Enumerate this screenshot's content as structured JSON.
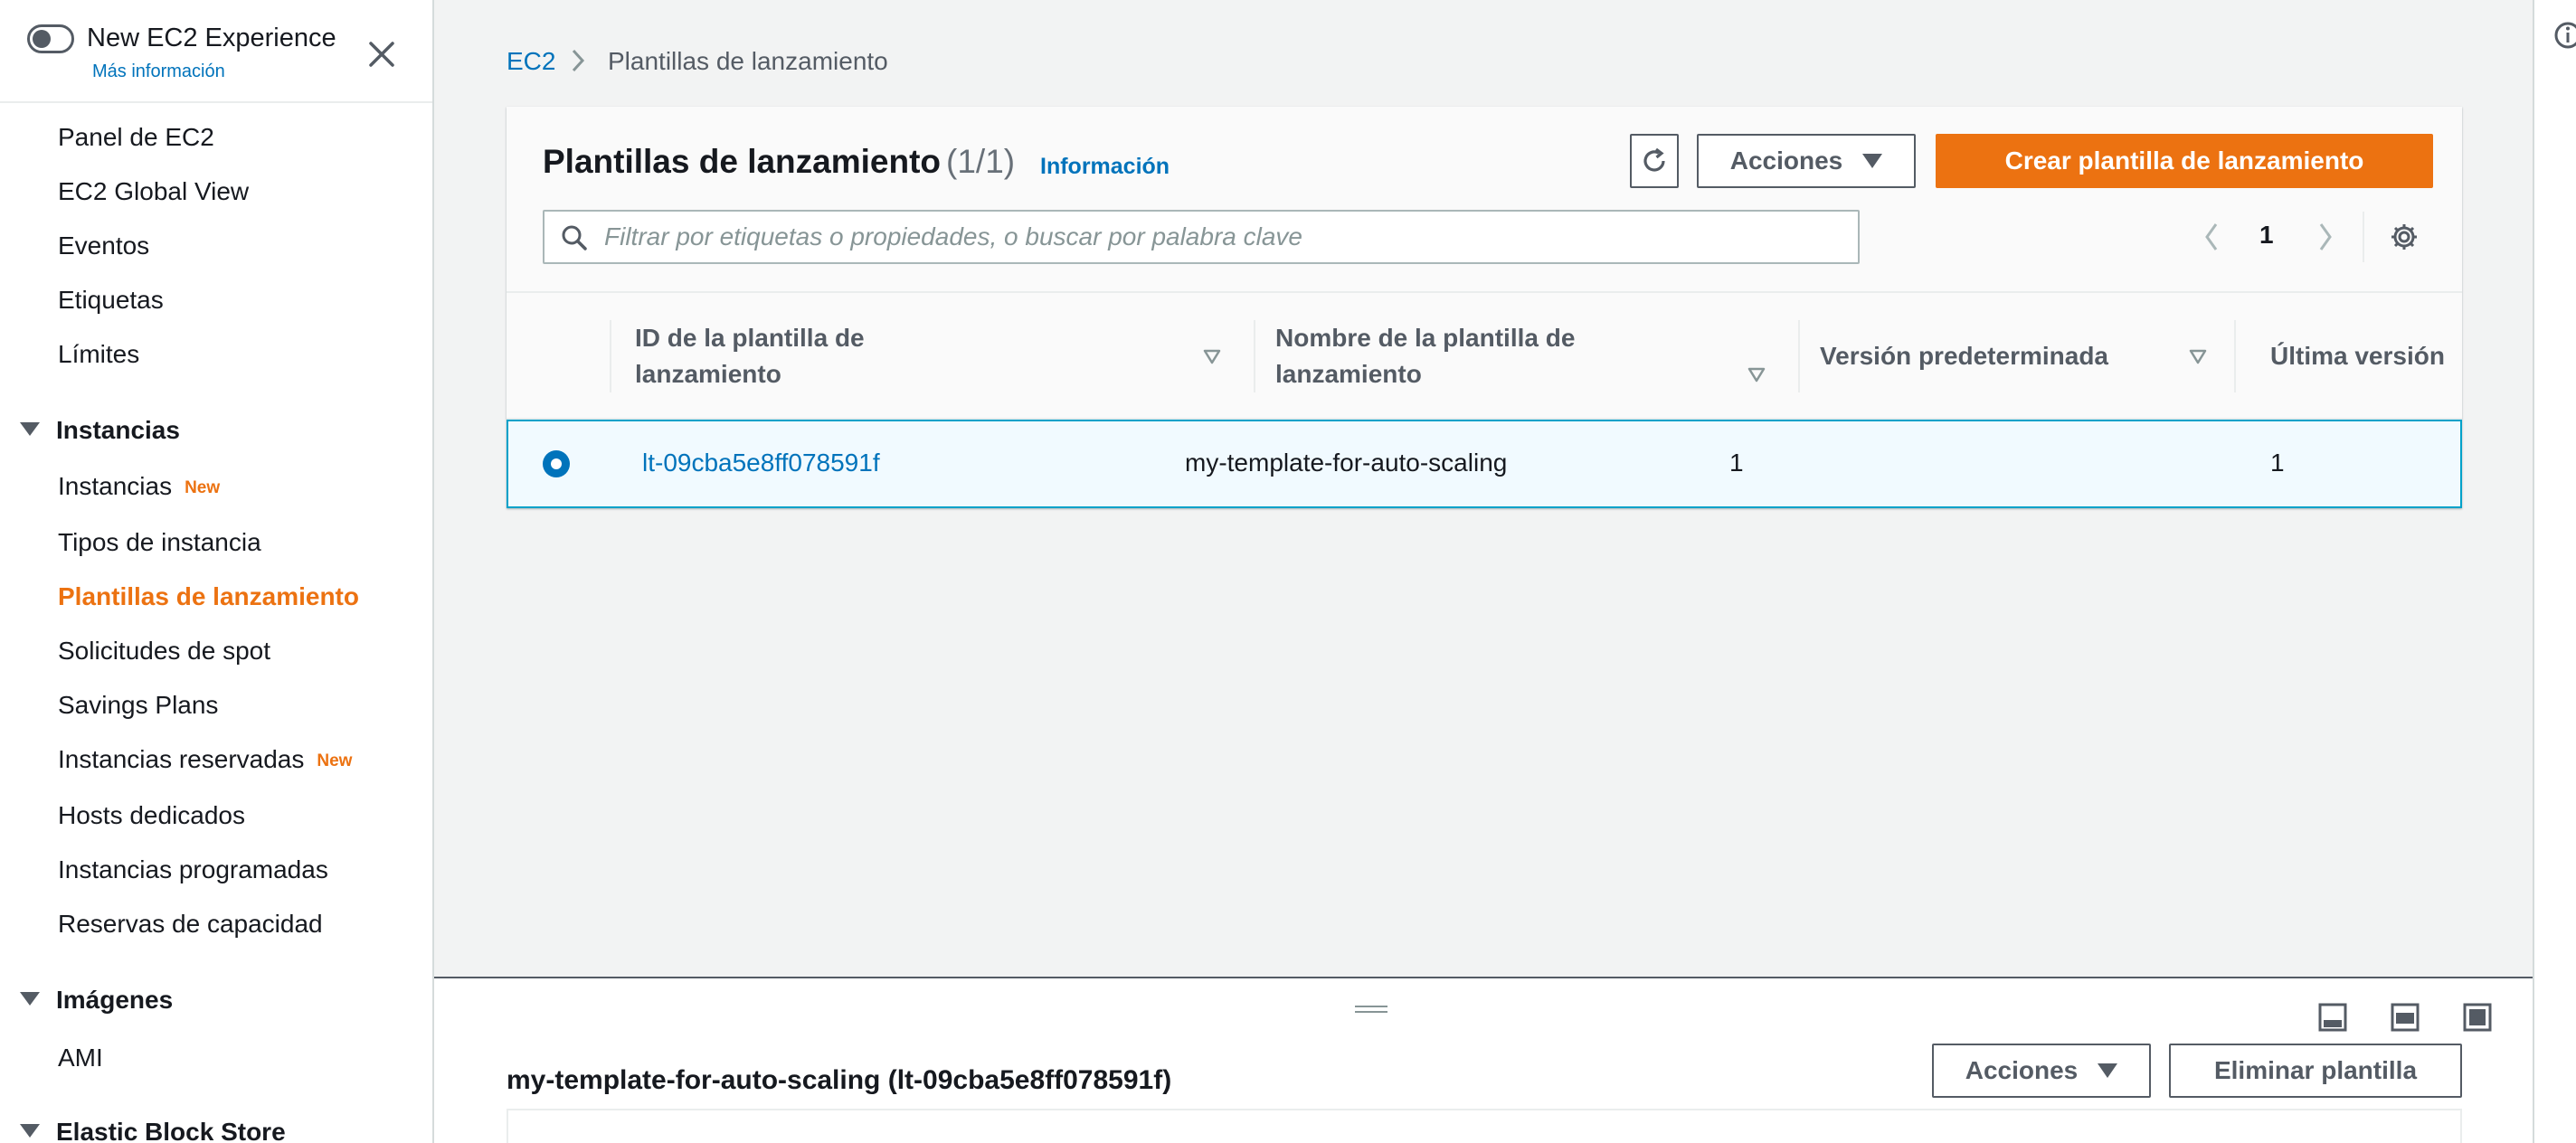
{
  "sidebar": {
    "experience_title": "New EC2 Experience",
    "experience_link": "Más información",
    "items": [
      {
        "label": "Panel de EC2"
      },
      {
        "label": "EC2 Global View"
      },
      {
        "label": "Eventos"
      },
      {
        "label": "Etiquetas"
      },
      {
        "label": "Límites"
      }
    ],
    "sections": [
      {
        "label": "Instancias"
      },
      {
        "label": "Imágenes"
      },
      {
        "label": "Elastic Block Store"
      }
    ],
    "instances_items": [
      {
        "label": "Instancias",
        "badge": "New"
      },
      {
        "label": "Tipos de instancia"
      },
      {
        "label": "Plantillas de lanzamiento",
        "active": true
      },
      {
        "label": "Solicitudes de spot"
      },
      {
        "label": "Savings Plans"
      },
      {
        "label": "Instancias reservadas",
        "badge": "New"
      },
      {
        "label": "Hosts dedicados"
      },
      {
        "label": "Instancias programadas"
      },
      {
        "label": "Reservas de capacidad"
      }
    ],
    "images_items": [
      {
        "label": "AMI"
      }
    ]
  },
  "breadcrumb": {
    "root": "EC2",
    "current": "Plantillas de lanzamiento"
  },
  "panel": {
    "title": "Plantillas de lanzamiento",
    "count": "(1/1)",
    "info": "Información",
    "actions_label": "Acciones",
    "create_label": "Crear plantilla de lanzamiento",
    "search_placeholder": "Filtrar por etiquetas o propiedades, o buscar por palabra clave",
    "page": "1"
  },
  "table": {
    "columns": [
      "ID de la plantilla de lanzamiento",
      "Nombre de la plantilla de lanzamiento",
      "Versión predeterminada",
      "Última versión"
    ],
    "rows": [
      {
        "id": "lt-09cba5e8ff078591f",
        "name": "my-template-for-auto-scaling",
        "default_version": "1",
        "latest_version": "1",
        "selected": true
      }
    ]
  },
  "details": {
    "title": "my-template-for-auto-scaling (lt-09cba5e8ff078591f)",
    "actions_label": "Acciones",
    "delete_label": "Eliminar plantilla"
  },
  "colors": {
    "accent": "#ec7211",
    "link": "#0073bb",
    "selected_row": "#f1faff",
    "selected_border": "#00a1c9"
  },
  "icons": [
    "toggle-switch",
    "close-icon",
    "chevron-right-icon",
    "refresh-icon",
    "caret-down-icon",
    "search-icon",
    "chevron-left-icon",
    "gear-icon",
    "sort-icon",
    "panel-bottom-icon",
    "panel-side-icon",
    "panel-full-icon",
    "info-icon"
  ]
}
